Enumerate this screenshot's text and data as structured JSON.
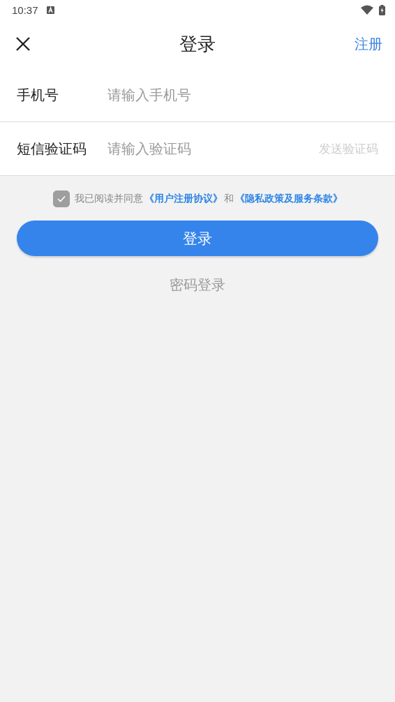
{
  "status_bar": {
    "time": "10:37"
  },
  "header": {
    "title": "登录",
    "action": "注册"
  },
  "fields": [
    {
      "label": "手机号",
      "placeholder": "请输入手机号"
    },
    {
      "label": "短信验证码",
      "placeholder": "请输入验证码",
      "action": "发送验证码"
    }
  ],
  "agreement": {
    "checked": true,
    "text": "我已阅读并同意",
    "link_1": "《用户注册协议》",
    "joiner": "和",
    "link_2": "《隐私政策及服务条款》"
  },
  "login_button": "登录",
  "alt_login": "密码登录"
}
